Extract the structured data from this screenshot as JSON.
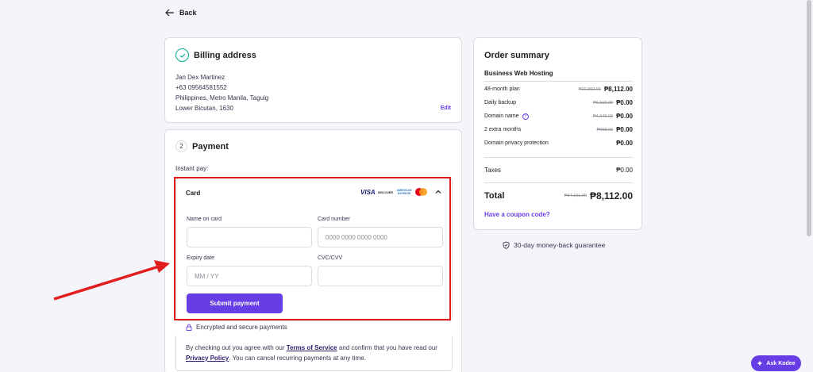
{
  "back_label": "Back",
  "billing": {
    "title": "Billing address",
    "lines": [
      "Jan Dex Martinez",
      "+63 09564581552",
      "Philippines, Metro Manila, Taguig",
      "Lower Bicutan, 1630"
    ],
    "edit_label": "Edit"
  },
  "payment": {
    "step": "2",
    "title": "Payment",
    "instant_label": "Instant pay:",
    "card": {
      "title": "Card",
      "brands": {
        "visa": "VISA",
        "discover": "DISCOVER",
        "amex": "AMERICAN EXPRESS"
      },
      "name_label": "Name on card",
      "name_value": "",
      "number_label": "Card number",
      "number_placeholder": "0000 0000 0000 0000",
      "expiry_label": "Expiry date",
      "expiry_placeholder": "MM / YY",
      "cvc_label": "CVC/CVV",
      "cvc_value": "",
      "submit_label": "Submit payment"
    },
    "secure_label": "Encrypted and secure payments",
    "terms": {
      "pre": "By checking out you agree with our ",
      "tos": "Terms of Service",
      "mid": " and confirm that you have read our ",
      "privacy": "Privacy Policy",
      "post": ". You can cancel recurring payments at any time."
    }
  },
  "summary": {
    "title": "Order summary",
    "product": "Business Web Hosting",
    "items": [
      {
        "label": "48-month plan",
        "old": "₱22,992.00",
        "value": "₱8,112.00"
      },
      {
        "label": "Daily backup",
        "old": "₱6,192.00",
        "value": "₱0.00"
      },
      {
        "label": "Domain name",
        "old": "₱4,049.00",
        "value": "₱0.00"
      },
      {
        "label": "2 extra months",
        "old": "₱958.00",
        "value": "₱0.00"
      },
      {
        "label": "Domain privacy protection",
        "old": "",
        "value": "₱0.00"
      }
    ],
    "taxes_label": "Taxes",
    "taxes_value": "₱0.00",
    "total_label": "Total",
    "total_old": "₱34,191.00",
    "total_value": "₱8,112.00",
    "coupon_label": "Have a coupon code?"
  },
  "guarantee_label": "30-day money-back guarantee",
  "kodee_label": "Ask Kodee",
  "colors": {
    "accent": "#673de6",
    "annotation": "#e11d1d",
    "success": "#00b090"
  }
}
